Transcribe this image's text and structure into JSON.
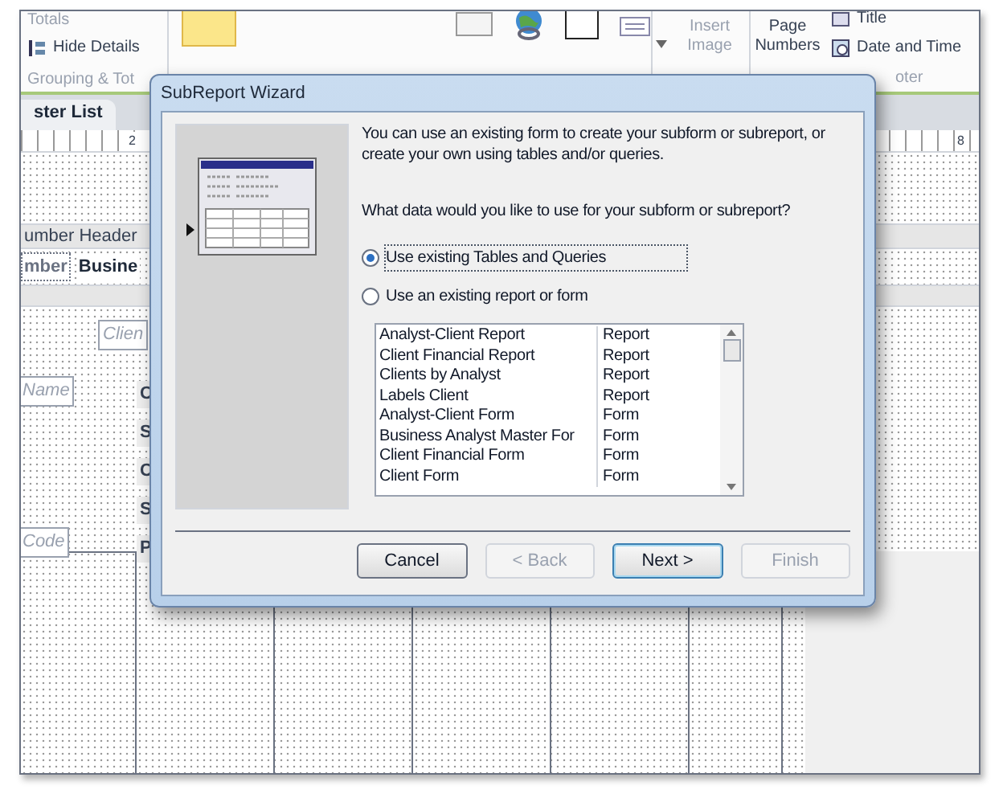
{
  "ribbon": {
    "totals": "Totals",
    "hide_details": "Hide Details",
    "grouping_caption": "Grouping & Tot",
    "insert_image": {
      "label": "Insert Image",
      "disabled": true
    },
    "page_numbers": "Page Numbers",
    "title": "Title",
    "date_time": "Date and Time",
    "footer_caption": "oter"
  },
  "document_tab": {
    "label": "ster List",
    "selected": true
  },
  "ruler": [
    "2",
    "8"
  ],
  "report": {
    "section_header": "umber Header",
    "header_labels": [
      "mber",
      "Busine"
    ],
    "controls": [
      "Clien",
      "Name",
      "Code"
    ],
    "field_labels": [
      "C",
      "S",
      "C",
      "S",
      "P"
    ]
  },
  "dialog": {
    "title": "SubReport Wizard",
    "intro": "You can use an existing form to create your subform or subreport, or create your own using tables and/or queries.",
    "question": "What data would you like to use for your subform or subreport?",
    "options": [
      {
        "label": "Use existing Tables and Queries",
        "selected": true
      },
      {
        "label": "Use an existing report or form",
        "selected": false
      }
    ],
    "list": [
      {
        "name": "Analyst-Client Report",
        "type": "Report"
      },
      {
        "name": "Client Financial Report",
        "type": "Report"
      },
      {
        "name": "Clients by Analyst",
        "type": "Report"
      },
      {
        "name": "Labels Client",
        "type": "Report"
      },
      {
        "name": "Analyst-Client Form",
        "type": "Form"
      },
      {
        "name": "Business Analyst Master For",
        "type": "Form"
      },
      {
        "name": "Client Financial Form",
        "type": "Form"
      },
      {
        "name": "Client Form",
        "type": "Form"
      }
    ],
    "buttons": [
      {
        "label": "Cancel",
        "disabled": false,
        "default": false
      },
      {
        "label": "< Back",
        "disabled": true,
        "default": false
      },
      {
        "label": "Next >",
        "disabled": false,
        "default": true
      },
      {
        "label": "Finish",
        "disabled": true,
        "default": false
      }
    ]
  }
}
